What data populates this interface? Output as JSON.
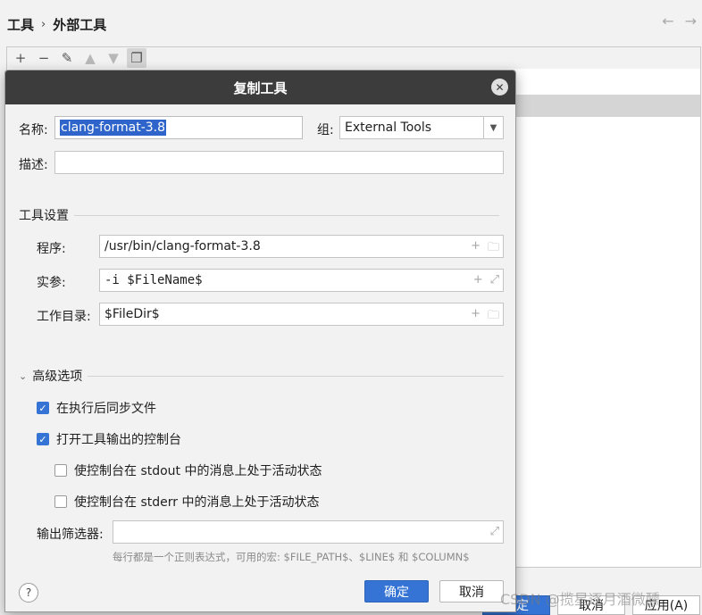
{
  "background": {
    "breadcrumb": [
      "工具",
      "外部工具"
    ],
    "toolbar_icons": [
      "add-icon",
      "remove-icon",
      "edit-icon",
      "move-up-icon",
      "move-down-icon",
      "copy-icon"
    ],
    "bottom_buttons": [
      "确定",
      "取消",
      "应用(A)"
    ]
  },
  "dialog": {
    "title": "复制工具",
    "name_label": "名称:",
    "name_value": "clang-format-3.8",
    "group_label": "组:",
    "group_value": "External Tools",
    "description_label": "描述:",
    "description_value": "",
    "tool_settings": {
      "heading": "工具设置",
      "program_label": "程序:",
      "program_value": "/usr/bin/clang-format-3.8",
      "args_label": "实参:",
      "args_value": "-i $FileName$",
      "workdir_label": "工作目录:",
      "workdir_value": "$FileDir$"
    },
    "advanced": {
      "heading": "高级选项",
      "sync_files": {
        "label": "在执行后同步文件",
        "checked": true
      },
      "open_console": {
        "label": "打开工具输出的控制台",
        "checked": true
      },
      "activate_stdout": {
        "label": "使控制台在 stdout 中的消息上处于活动状态",
        "checked": false
      },
      "activate_stderr": {
        "label": "使控制台在 stderr 中的消息上处于活动状态",
        "checked": false
      },
      "output_filters_label": "输出筛选器:",
      "output_filters_value": "",
      "hint": "每行都是一个正则表达式，可用的宏: $FILE_PATH$、$LINE$ 和 $COLUMN$"
    },
    "help": "?",
    "ok_label": "确定",
    "cancel_label": "取消"
  },
  "watermark": "CSDN @揽星逐月酒微醺",
  "colors": {
    "title_bar": "#3c3c3c",
    "accent": "#3574d4",
    "selection": "#2f65ca"
  }
}
